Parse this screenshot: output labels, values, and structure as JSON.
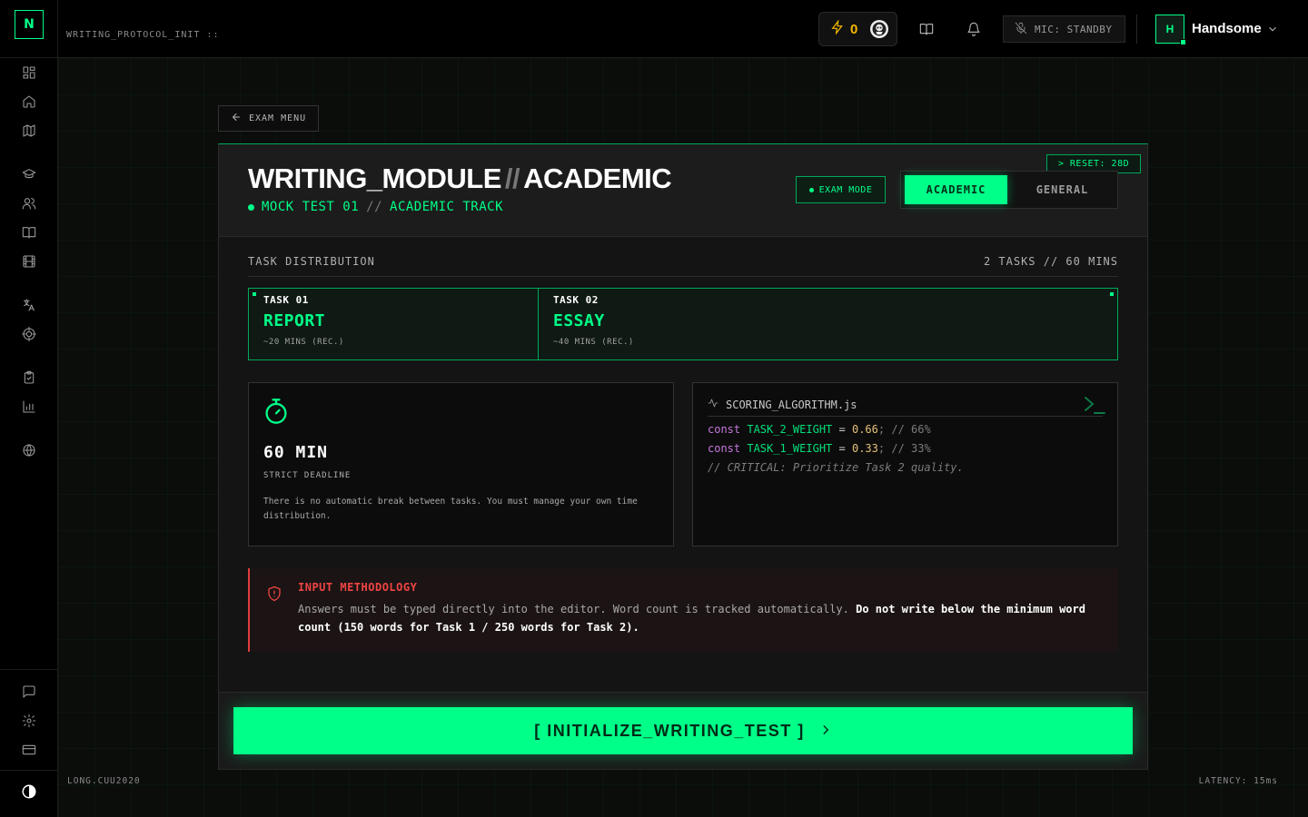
{
  "sidebar": {
    "logo": "N",
    "items": [
      {
        "icon": "dashboard-icon"
      },
      {
        "icon": "home-icon"
      },
      {
        "icon": "map-icon"
      },
      {
        "icon": "graduation-cap-icon"
      },
      {
        "icon": "users-icon"
      },
      {
        "icon": "book-icon"
      },
      {
        "icon": "film-icon"
      },
      {
        "icon": "translate-icon"
      },
      {
        "icon": "target-icon"
      },
      {
        "icon": "clipboard-check-icon"
      },
      {
        "icon": "bar-chart-icon"
      },
      {
        "icon": "globe-icon"
      }
    ],
    "bottom_items": [
      {
        "icon": "message-icon"
      },
      {
        "icon": "settings-icon"
      },
      {
        "icon": "credit-card-icon"
      },
      {
        "icon": "theme-contrast-icon"
      }
    ]
  },
  "header": {
    "protocol_label": "WRITING_PROTOCOL_INIT ::",
    "streak_count": "0",
    "mic_status": "MIC: STANDBY",
    "avatar_initial": "H",
    "username": "Handsome"
  },
  "back_button": {
    "label": "EXAM MENU"
  },
  "module": {
    "title_left": "WRITING_MODULE",
    "title_sep": "//",
    "title_right": "ACADEMIC",
    "subtitle_left": "MOCK TEST 01",
    "subtitle_sep": "//",
    "subtitle_right": "ACADEMIC TRACK",
    "reset_label": "> RESET: 28D",
    "exam_mode_label": "EXAM MODE",
    "modes": [
      {
        "label": "ACADEMIC",
        "active": true
      },
      {
        "label": "GENERAL",
        "active": false
      }
    ]
  },
  "distribution": {
    "label": "TASK DISTRIBUTION",
    "summary": "2 TASKS // 60 MINS",
    "tasks": [
      {
        "number": "TASK 01",
        "name": "REPORT",
        "time": "~20 MINS (REC.)"
      },
      {
        "number": "TASK 02",
        "name": "ESSAY",
        "time": "~40 MINS (REC.)"
      }
    ]
  },
  "deadline": {
    "value": "60 MIN",
    "label": "STRICT DEADLINE",
    "note": "There is no automatic break between tasks. You must manage your own time distribution."
  },
  "code": {
    "filename": "SCORING_ALGORITHM.js",
    "lines": [
      {
        "kw": "const",
        "var": "TASK_2_WEIGHT",
        "op": "=",
        "num": "0.66",
        "comment": "; // 66%"
      },
      {
        "kw": "const",
        "var": "TASK_1_WEIGHT",
        "op": "=",
        "num": "0.33",
        "comment": "; // 33%"
      }
    ],
    "critical_comment": "// CRITICAL: Prioritize Task 2 quality."
  },
  "warning": {
    "title": "INPUT METHODOLOGY",
    "text": "Answers must be typed directly into the editor. Word count is tracked automatically.",
    "emphasis": "Do not write below the minimum word count (150 words for Task 1 / 250 words for Task 2)."
  },
  "cta": {
    "label": "[ INITIALIZE_WRITING_TEST ]"
  },
  "footer": {
    "left": "LONG.CUU2020",
    "right": "LATENCY: 15ms"
  },
  "colors": {
    "accent": "#00ff88",
    "warning": "#ef4444",
    "streak": "#f5b800"
  }
}
